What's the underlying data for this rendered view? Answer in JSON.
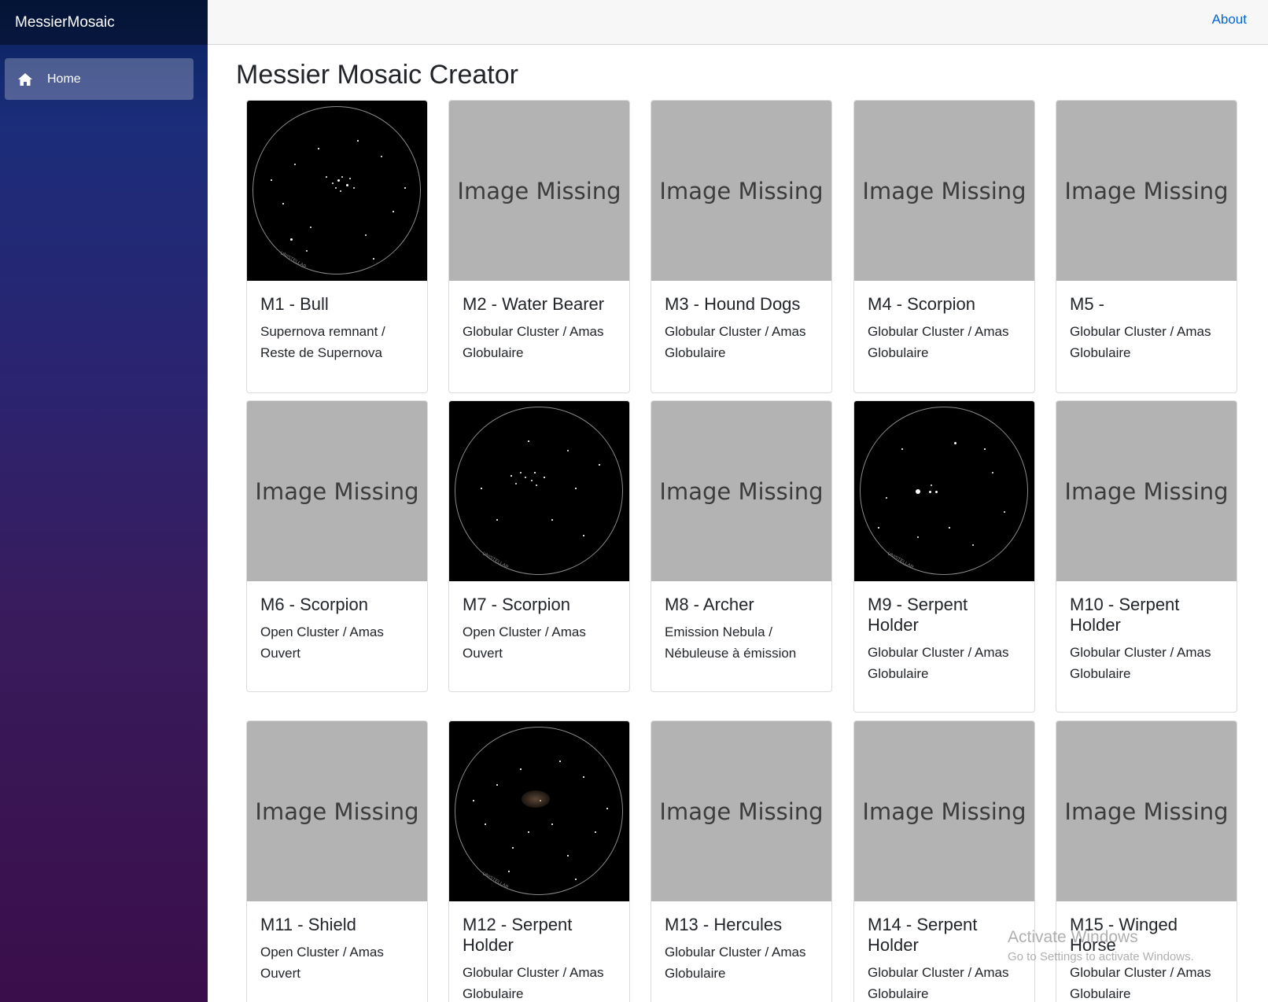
{
  "brand": "MessierMosaic",
  "nav": {
    "home_label": "Home"
  },
  "topbar": {
    "about_label": "About"
  },
  "page_title": "Messier Mosaic Creator",
  "placeholder_text": "Image Missing",
  "cards": [
    {
      "title": "M1 - Bull",
      "desc": "Supernova remnant / Reste de Supernova",
      "has_image": true
    },
    {
      "title": "M2 - Water Bearer",
      "desc": "Globular Cluster / Amas Globulaire",
      "has_image": false
    },
    {
      "title": "M3 - Hound Dogs",
      "desc": "Globular Cluster / Amas Globulaire",
      "has_image": false
    },
    {
      "title": "M4 - Scorpion",
      "desc": "Globular Cluster / Amas Globulaire",
      "has_image": false
    },
    {
      "title": "M5 -",
      "desc": "Globular Cluster / Amas Globulaire",
      "has_image": false
    },
    {
      "title": "M6 - Scorpion",
      "desc": "Open Cluster / Amas Ouvert",
      "has_image": false
    },
    {
      "title": "M7 - Scorpion",
      "desc": "Open Cluster / Amas Ouvert",
      "has_image": true
    },
    {
      "title": "M8 - Archer",
      "desc": "Emission Nebula / Nébuleuse à émission",
      "has_image": false
    },
    {
      "title": "M9 - Serpent Holder",
      "desc": "Globular Cluster / Amas Globulaire",
      "has_image": true
    },
    {
      "title": "M10 - Serpent Holder",
      "desc": "Globular Cluster / Amas Globulaire",
      "has_image": false
    },
    {
      "title": "M11 - Shield",
      "desc": "Open Cluster / Amas Ouvert",
      "has_image": false
    },
    {
      "title": "M12 - Serpent Holder",
      "desc": "Globular Cluster / Amas Globulaire",
      "has_image": true
    },
    {
      "title": "M13 - Hercules",
      "desc": "Globular Cluster / Amas Globulaire",
      "has_image": false
    },
    {
      "title": "M14 - Serpent Holder",
      "desc": "Globular Cluster / Amas Globulaire",
      "has_image": false
    },
    {
      "title": "M15 - Winged Horse",
      "desc": "Globular Cluster / Amas Globulaire",
      "has_image": false
    }
  ],
  "image_watermark": "UNISTELLAR",
  "os_notice": {
    "title": "Activate Windows",
    "subtitle": "Go to Settings to activate Windows."
  }
}
